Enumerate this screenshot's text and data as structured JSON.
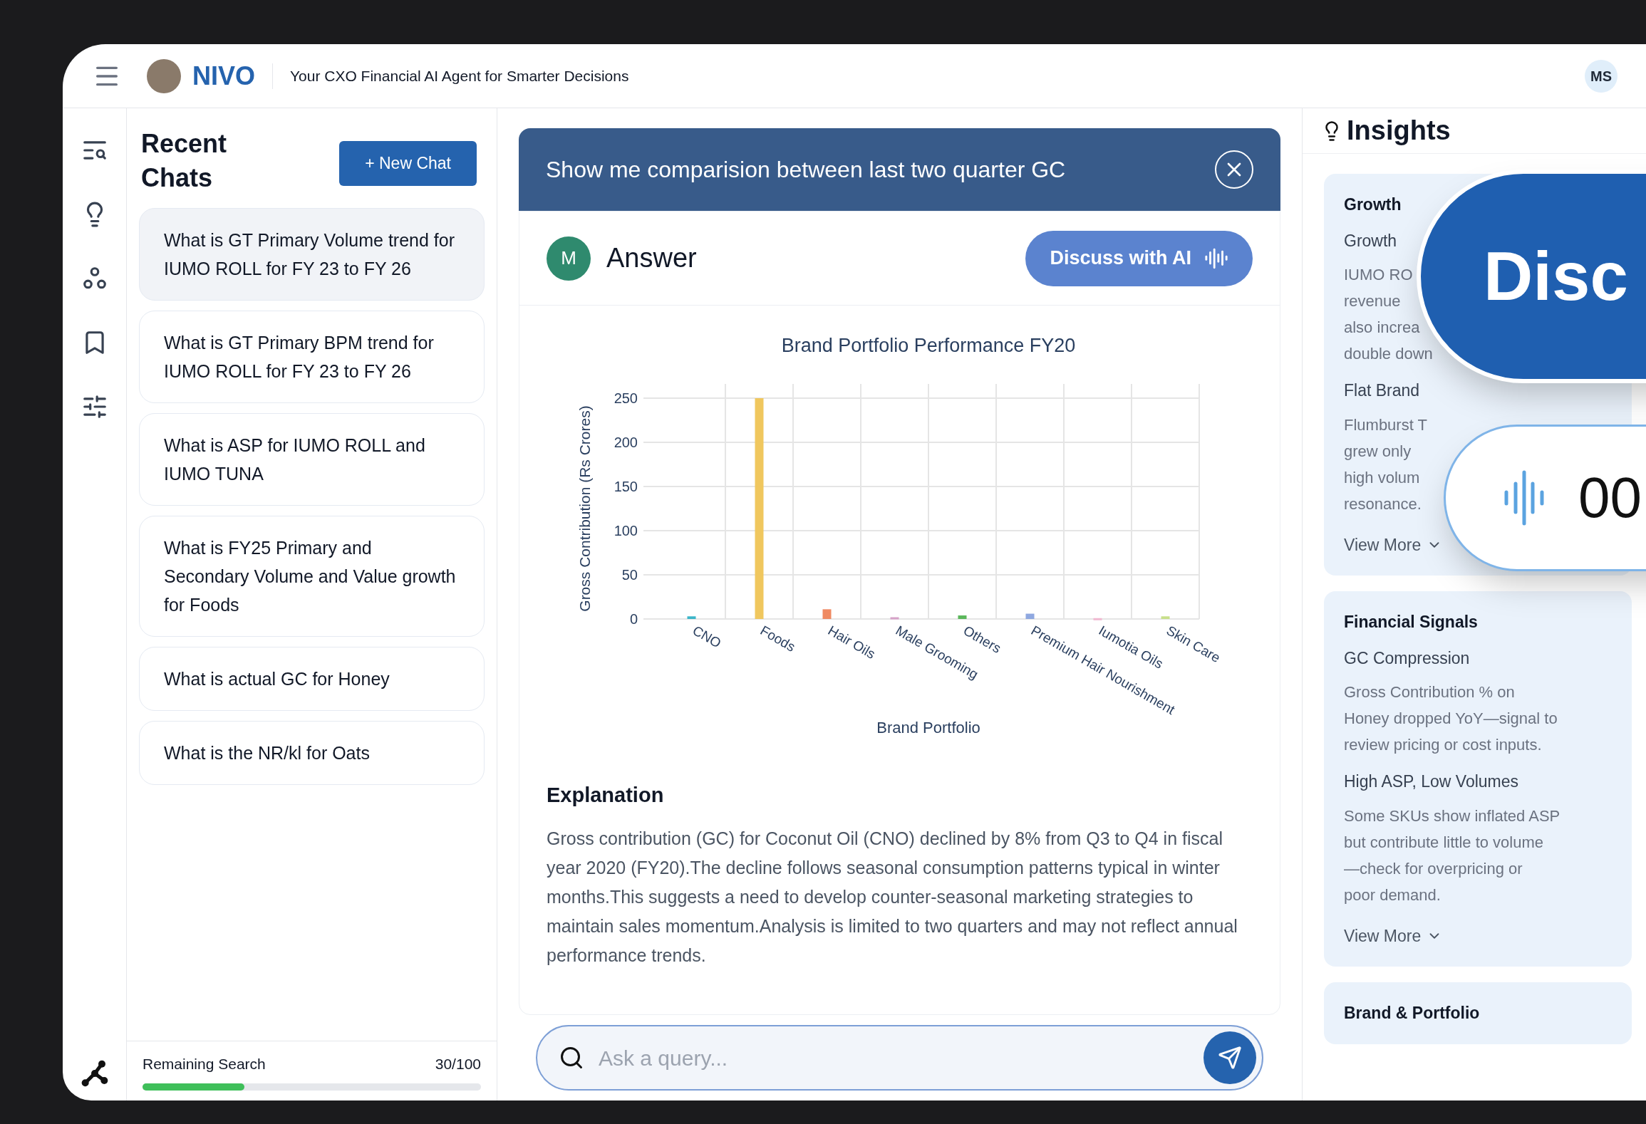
{
  "header": {
    "brand": "NIVO",
    "tagline": "Your CXO Financial AI Agent for Smarter Decisions",
    "user_initials": "MS"
  },
  "recent_chats": {
    "title": "Recent Chats",
    "new_chat_button": "+ New Chat",
    "items": [
      {
        "text": "What is GT Primary Volume trend for IUMO ROLL for FY 23 to FY 26",
        "selected": true
      },
      {
        "text": "What is GT Primary BPM trend for IUMO ROLL for FY 23 to FY 26",
        "selected": false
      },
      {
        "text": "What is ASP for IUMO ROLL and IUMO TUNA",
        "selected": false
      },
      {
        "text": "What is FY25 Primary and Secondary Volume and Value growth for Foods",
        "selected": false
      },
      {
        "text": "What is actual GC for Honey",
        "selected": false
      },
      {
        "text": "What is the NR/kl for Oats",
        "selected": false
      }
    ],
    "remaining": {
      "label": "Remaining Search",
      "count": "30/100",
      "level": 0.3
    }
  },
  "query": {
    "text": "Show me comparision between last two quarter GC"
  },
  "answer": {
    "avatar": "M",
    "title": "Answer",
    "discuss_button": "Discuss with AI",
    "chart_data": {
      "type": "bar",
      "title": "Brand Portfolio Performance FY20",
      "xlabel": "Brand Portfolio",
      "ylabel": "Gross Contribution (Rs Crores)",
      "grid": true,
      "categories": [
        "CNO",
        "Foods",
        "Hair Oils",
        "Male Grooming",
        "Others",
        "Premium Hair Nourishment",
        "Iumotia Oils",
        "Skin Care"
      ],
      "values": [
        3,
        250,
        11,
        2,
        4,
        6,
        1,
        3
      ],
      "colors": [
        "#3cb6c9",
        "#f0c75e",
        "#ef8a62",
        "#d6a2c8",
        "#5bb75b",
        "#8fa8e0",
        "#f0b8d0",
        "#c8e08a"
      ],
      "ylim": [
        0,
        250
      ],
      "yticks": [
        0,
        50,
        100,
        150,
        200,
        250
      ]
    },
    "explanation_title": "Explanation",
    "explanation": "Gross contribution (GC) for Coconut Oil (CNO) declined by 8% from Q3 to Q4 in fiscal year 2020 (FY20).The decline follows seasonal consumption patterns typical in winter months.This suggests a need to develop counter-seasonal marketing strategies to maintain sales momentum.Analysis is limited to two quarters and may not reflect annual performance trends."
  },
  "input": {
    "placeholder": "Ask a query..."
  },
  "insights": {
    "title": "Insights",
    "cards": [
      {
        "title": "Growth",
        "sections": [
          {
            "heading": "Growth",
            "lines": [
              "IUMO RO",
              "revenue",
              "also increa",
              "double down"
            ]
          },
          {
            "heading": "Flat Brand",
            "lines": [
              "Flumburst T",
              "grew only",
              "high volum",
              "resonance."
            ]
          }
        ],
        "link": "View More"
      },
      {
        "title": "Financial Signals",
        "sections": [
          {
            "heading": "GC Compression",
            "lines": [
              "Gross Contribution % on",
              "Honey dropped YoY—signal to",
              "review pricing or cost inputs."
            ]
          },
          {
            "heading": "High ASP, Low Volumes",
            "lines": [
              "Some SKUs show inflated ASP",
              "but contribute little to volume",
              "—check for overpricing or",
              "poor demand."
            ]
          }
        ],
        "link": "View More"
      },
      {
        "title": "Brand & Portfolio"
      }
    ]
  },
  "overlay": {
    "discuss_label": "Disc",
    "timer": "00"
  }
}
